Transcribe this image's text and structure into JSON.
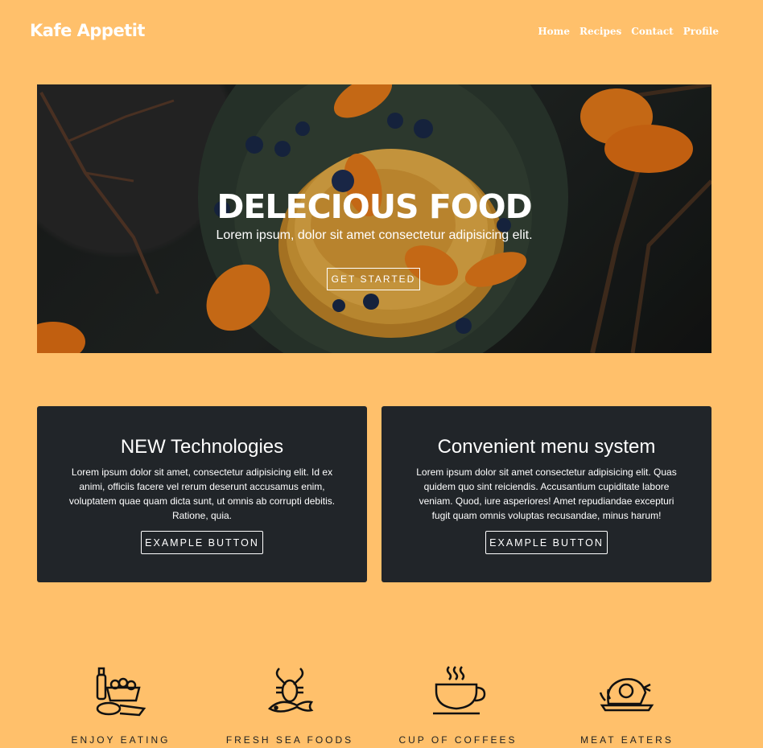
{
  "header": {
    "brand": "Kafe Appetit",
    "nav": [
      "Home",
      "Recipes",
      "Contact",
      "Profile"
    ]
  },
  "hero": {
    "title": "DELECIOUS FOOD",
    "subtitle": "Lorem ipsum, dolor sit amet consectetur adipisicing elit.",
    "button": "GET STARTED"
  },
  "cards": [
    {
      "title": "NEW Technologies",
      "text": "Lorem ipsum dolor sit amet, consectetur adipisicing elit. Id ex animi, officiis facere vel rerum deserunt accusamus enim, voluptatem quae quam dicta sunt, ut omnis ab corrupti debitis. Ratione, quia.",
      "button": "EXAMPLE BUTTON"
    },
    {
      "title": "Convenient menu system",
      "text": "Lorem ipsum dolor sit amet consectetur adipisicing elit. Quas quidem quo sint reiciendis. Accusantium cupiditate labore veniam. Quod, iure asperiores! Amet repudiandae excepturi fugit quam omnis voluptas recusandae, minus harum!",
      "button": "EXAMPLE BUTTON"
    }
  ],
  "features": [
    {
      "label": "ENJOY EATING",
      "icon": "groceries-icon"
    },
    {
      "label": "FRESH SEA FOODS",
      "icon": "seafood-icon"
    },
    {
      "label": "CUP OF COFFEES",
      "icon": "coffee-cup-icon"
    },
    {
      "label": "MEAT EATERS",
      "icon": "roast-chicken-icon"
    }
  ],
  "colors": {
    "page_background": "#ffc06b",
    "card_background": "#212529",
    "text_light": "#ffffff",
    "feature_text": "#222222"
  }
}
